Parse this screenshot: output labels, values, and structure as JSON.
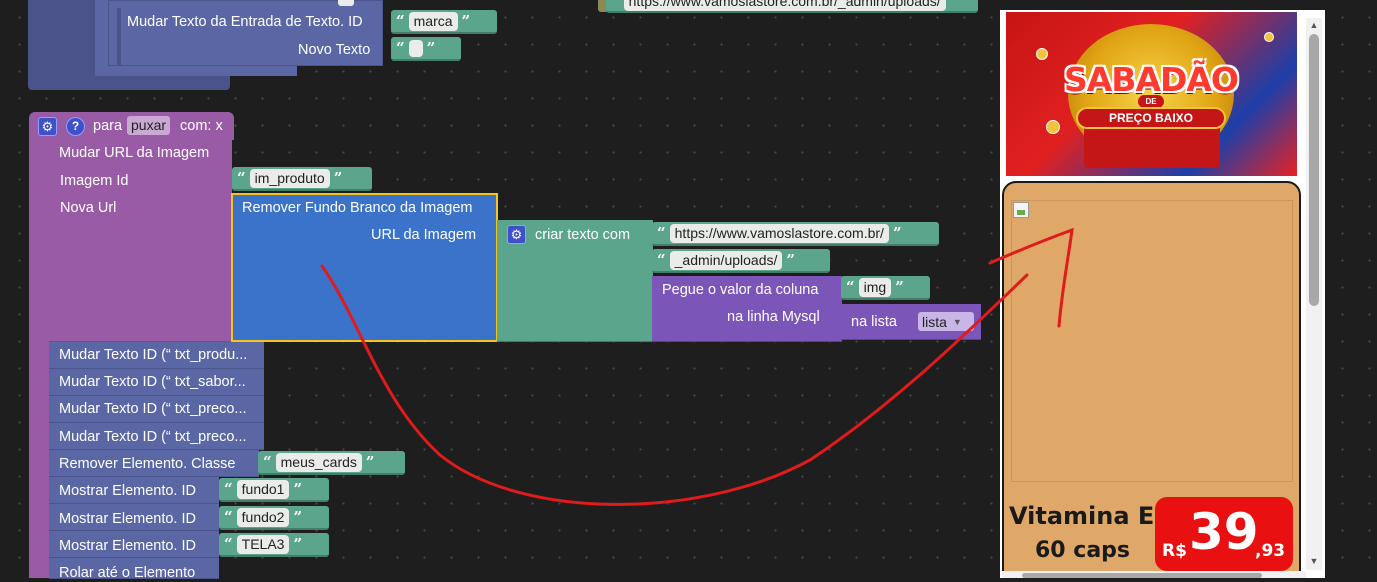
{
  "top": {
    "change_input_label": "Mudar Texto da Entrada de Texto. ID",
    "change_input_id": "marca",
    "new_text_label": "Novo Texto",
    "new_text_value": "",
    "url_top": "https://www.vamoslastore.com.br/_admin/uploads/"
  },
  "proc": {
    "to_label": "para",
    "name": "puxar",
    "params": "com: x",
    "set_image_url": "Mudar URL da Imagem",
    "image_id_label": "Imagem Id",
    "image_id_value": "im_produto",
    "new_url_label": "Nova Url",
    "remove_bg_label": "Remover Fundo Branco da Imagem",
    "image_url_label": "URL da Imagem",
    "join_label": "criar texto com",
    "join_part1": "https://www.vamoslastore.com.br/",
    "join_part2": "_admin/uploads/",
    "column_value_label": "Pegue o valor da coluna",
    "column_value": "img",
    "mysql_row_label": "na linha Mysql",
    "in_list_label": "na lista",
    "list_value": "lista",
    "text_rows": [
      "Mudar Texto ID (“ txt_produ...",
      "Mudar Texto ID (“ txt_sabor...",
      "Mudar Texto ID (“ txt_preco...",
      "Mudar Texto ID (“ txt_preco..."
    ],
    "remove_class_label": "Remover Elemento. Classe",
    "remove_class_value": "meus_cards",
    "show_label": "Mostrar Elemento. ID",
    "show_ids": [
      "fundo1",
      "fundo2",
      "TELA3"
    ],
    "scroll_label": "Rolar até o Elemento"
  },
  "preview": {
    "banner_line1": "SABADÃO",
    "banner_line2": "DE",
    "banner_line3": "PREÇO BAIXO",
    "product_name": "Vitamina E",
    "product_qty": "60 caps",
    "price_currency": "R$",
    "price_int": "39",
    "price_dec": ",93"
  },
  "colors": {
    "workspace": "#1e1e1e",
    "procedure": "#995ba5",
    "component": "#5b67a5",
    "text": "#5ba58c",
    "image_block": "#3a73c9",
    "card": "#e0a868",
    "price_tag": "#e81010",
    "annotation": "#e01b1b"
  }
}
